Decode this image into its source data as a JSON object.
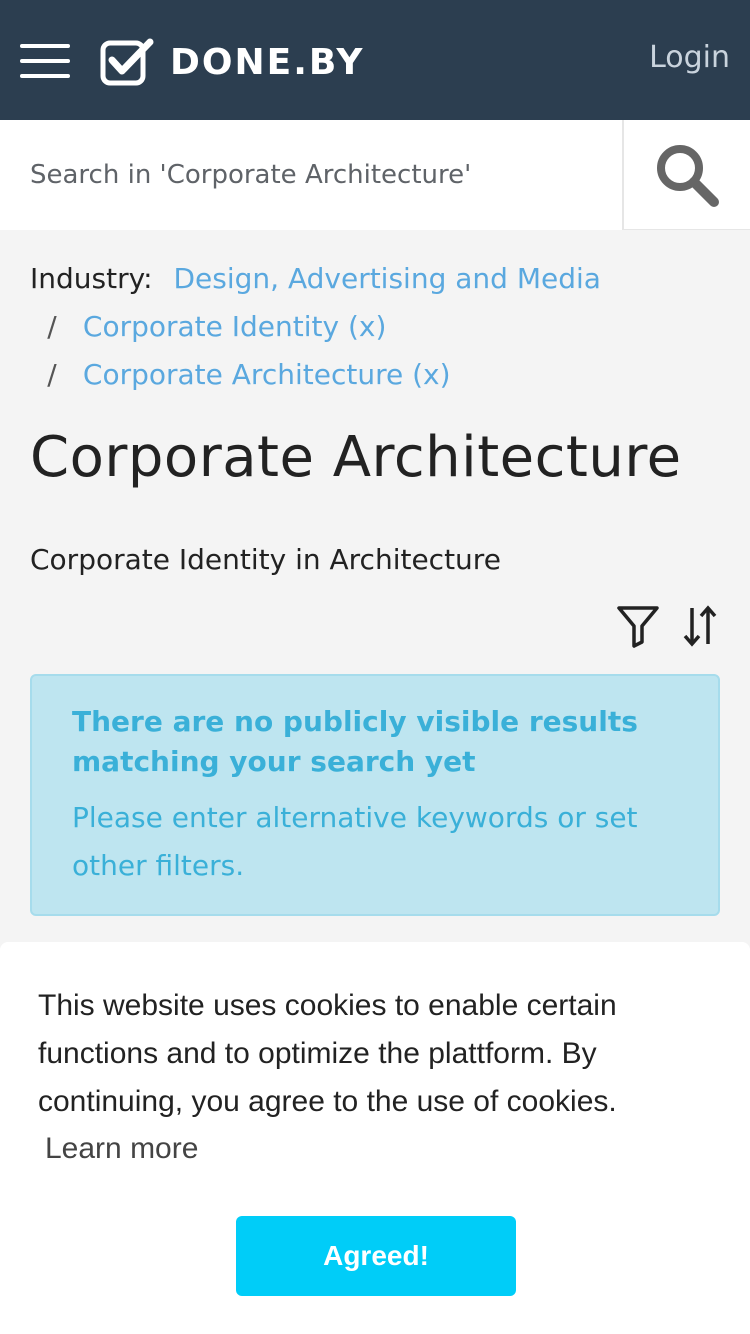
{
  "header": {
    "logo_text": "DONE.BY",
    "login_label": "Login",
    "bg_color": "#2c3e50"
  },
  "search": {
    "placeholder": "Search in 'Corporate Architecture'"
  },
  "breadcrumb": {
    "label": "Industry:",
    "items": [
      {
        "text": "Design, Advertising and Media"
      },
      {
        "separator": "/",
        "text": "Corporate Identity (x)"
      },
      {
        "separator": "/",
        "text": "Corporate Architecture (x)"
      }
    ]
  },
  "main": {
    "title": "Corporate Architecture",
    "subtitle": "Corporate Identity in Architecture"
  },
  "tools": {
    "icons": [
      "filter-icon",
      "sort-icon"
    ]
  },
  "info": {
    "title": "There are no publicly visible results matching your search yet",
    "text": "Please enter alternative keywords or set other filters."
  },
  "cookie": {
    "text": "This website uses cookies to enable certain functions and to optimize the plattform. By continuing, you agree to the use of cookies.",
    "learn_more": "Learn more",
    "button_label": "Agreed!",
    "button_color": "#00cdf8"
  }
}
